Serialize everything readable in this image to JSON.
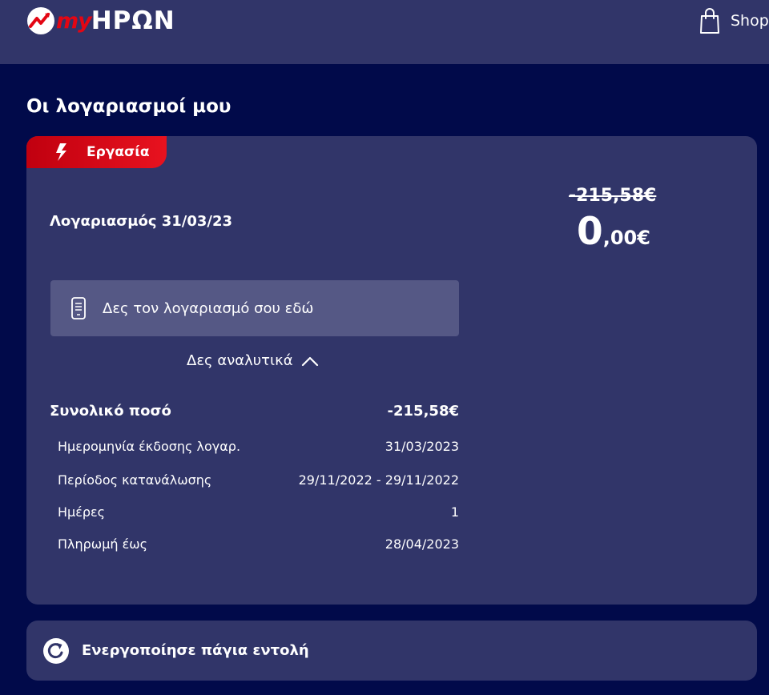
{
  "header": {
    "logo_prefix": "my",
    "logo_name": "ΗΡΩΝ",
    "shop_label": "Shop"
  },
  "page_title": "Οι λογαριασμοί μου",
  "bill": {
    "tag": "Εργασία",
    "title": "Λογαριασμός 31/03/23",
    "old_amount": "-215,58€",
    "new_amount_int": "0",
    "new_amount_dec": ",00€",
    "view_bill_label": "Δες τον λογαριασμό σου εδώ",
    "details_label": "Δες αναλυτικά",
    "total": {
      "label": "Συνολικό ποσό",
      "value": "-215,58€"
    },
    "details": [
      {
        "label": "Ημερομηνία έκδοσης λογαρ.",
        "value": "31/03/2023"
      },
      {
        "label": "Περίοδος κατανάλωσης",
        "value": "29/11/2022 - 29/11/2022"
      },
      {
        "label": "Ημέρες",
        "value": "1"
      },
      {
        "label": "Πληρωμή έως",
        "value": "28/04/2023"
      }
    ]
  },
  "standing_order": {
    "label": "Ενεργοποίησε πάγια εντολή"
  },
  "colors": {
    "page_bg": "#010a4a",
    "card_bg": "#313569",
    "accent_red": "#e30613",
    "button_bg": "#555885"
  },
  "icons": {
    "logo": "heron-logo-icon",
    "shop": "shopping-bag-icon",
    "tag": "lightning-icon",
    "view_bill": "phone-document-icon",
    "details": "chevron-up-icon",
    "standing_order": "refresh-icon"
  }
}
